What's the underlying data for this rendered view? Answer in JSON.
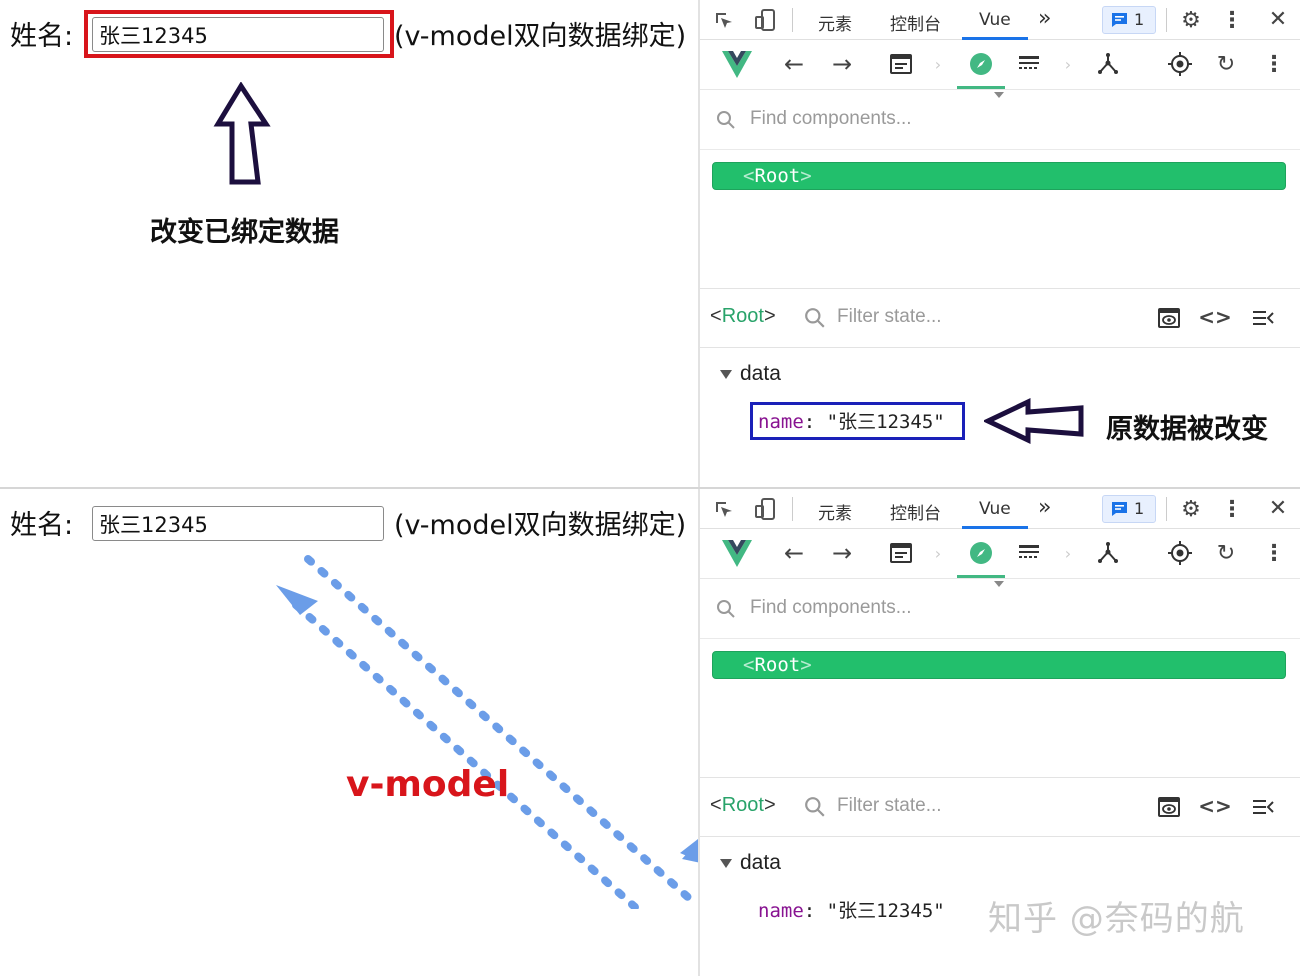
{
  "form": {
    "label": "姓名:",
    "value": "张三12345",
    "hint": "(v-model双向数据绑定)"
  },
  "annotations": {
    "change_bound": "改变已绑定数据",
    "data_changed": "原数据被改变",
    "vmodel": "v-model"
  },
  "devtools": {
    "tabs": [
      "元素",
      "控制台",
      "Vue"
    ],
    "more": "»",
    "issues_count": "1",
    "search_placeholder": "Find components...",
    "root_component": "Root",
    "inspector_tag": "Root",
    "filter_placeholder": "Filter state...",
    "data_section": "data",
    "property_key": "name",
    "property_sep": ":",
    "property_value": "\"张三12345\""
  },
  "watermark": "知乎 @奈码的航",
  "colors": {
    "vue_green": "#42b883",
    "root_bar": "#22bf6c",
    "highlight_red": "#d8151b",
    "highlight_blue": "#1a20b8",
    "arrow_blue": "#6b9de8",
    "active_tab": "#1a73e8"
  }
}
